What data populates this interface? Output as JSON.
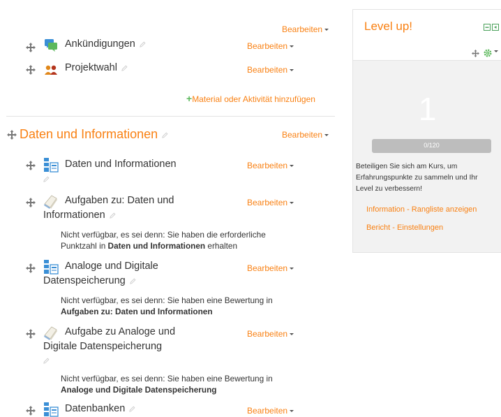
{
  "edit_label": "Bearbeiten",
  "section1": {
    "activities": [
      {
        "title": "Ankündigungen",
        "icon": "forum-icon"
      },
      {
        "title": "Projektwahl",
        "icon": "group-choice-icon"
      }
    ],
    "add_activity_label": "Material oder Aktivität hinzufügen"
  },
  "section2": {
    "title": "Daten und Informationen",
    "activities": [
      {
        "title": "Daten und Informationen",
        "icon": "page-icon"
      },
      {
        "title_line1": "Aufgaben zu: Daten und",
        "title_line2": "Informationen",
        "icon": "assignment-icon",
        "restriction_line1": "Nicht verfügbar, es sei denn: Sie haben die erforderliche",
        "restriction_prefix": "Punktzahl in ",
        "restriction_bold": "Daten und Informationen",
        "restriction_suffix": " erhalten"
      },
      {
        "title_line1": "Analoge und Digitale",
        "title_line2": "Datenspeicherung",
        "icon": "page-icon",
        "restriction_line1": "Nicht verfügbar, es sei denn: Sie haben eine Bewertung in",
        "restriction_bold": "Aufgaben zu: Daten und Informationen"
      },
      {
        "title_line1": "Aufgabe zu Analoge und",
        "title_line2": "Digitale Datenspeicherung",
        "icon": "assignment-icon",
        "restriction_line1": "Nicht verfügbar, es sei denn: Sie haben eine Bewertung in",
        "restriction_bold": "Analoge und Digitale Datenspeicherung"
      },
      {
        "title": "Datenbanken",
        "icon": "page-icon"
      }
    ]
  },
  "level_up_block": {
    "title": "Level up!",
    "level": "1",
    "progress_text": "0/120",
    "progress_fraction": 0,
    "description": "Beteiligen Sie sich am Kurs, um Erfahrungspunkte zu sammeln und Ihr Level zu verbessern!",
    "links": [
      "Information - Rangliste anzeigen",
      "Bericht - Einstellungen"
    ]
  },
  "colors": {
    "accent": "#f98012",
    "text": "#333333",
    "block_bg": "#f2f2f2",
    "progress": "#bdbdbd"
  }
}
